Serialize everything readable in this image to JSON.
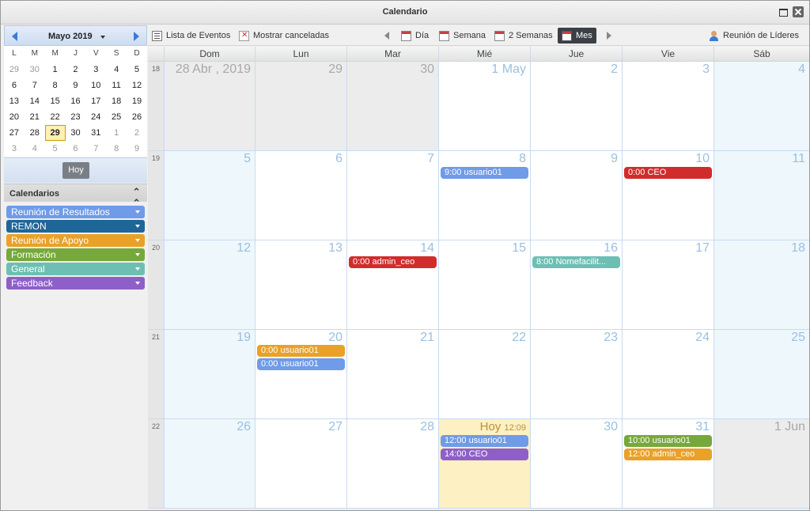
{
  "window": {
    "title": "Calendario"
  },
  "colors": {
    "reunion_resultados": "#6f9be8",
    "remon": "#1f6698",
    "reunion_apoyo": "#e9a128",
    "formacion": "#76a83b",
    "general": "#6dbfb3",
    "feedback": "#8e5fc9",
    "ceo_red": "#d12c2c"
  },
  "mini_calendar": {
    "month_label": "Mayo 2019",
    "dow": [
      "L",
      "M",
      "M",
      "J",
      "V",
      "S",
      "D"
    ],
    "weeks": [
      [
        "29",
        "30",
        "1",
        "2",
        "3",
        "4",
        "5"
      ],
      [
        "6",
        "7",
        "8",
        "9",
        "10",
        "11",
        "12"
      ],
      [
        "13",
        "14",
        "15",
        "16",
        "17",
        "18",
        "19"
      ],
      [
        "20",
        "21",
        "22",
        "23",
        "24",
        "25",
        "26"
      ],
      [
        "27",
        "28",
        "29",
        "30",
        "31",
        "1",
        "2"
      ],
      [
        "3",
        "4",
        "5",
        "6",
        "7",
        "8",
        "9"
      ]
    ],
    "today_button": "Hoy"
  },
  "calendars": {
    "header": "Calendarios",
    "items": [
      {
        "label": "Reunión de Resultados"
      },
      {
        "label": "REMON"
      },
      {
        "label": "Reunión de Apoyo"
      },
      {
        "label": "Formación"
      },
      {
        "label": "General"
      },
      {
        "label": "Feedback"
      }
    ]
  },
  "toolbar": {
    "event_list": "Lista de Eventos",
    "show_cancelled": "Mostrar canceladas",
    "day": "Día",
    "week": "Semana",
    "two_weeks": "2 Semanas",
    "month": "Mes",
    "leaders_meeting": "Reunión de Líderes"
  },
  "month_view": {
    "dow_headers": [
      "Dom",
      "Lun",
      "Mar",
      "Mié",
      "Jue",
      "Vie",
      "Sáb"
    ],
    "weeks": [
      {
        "week": "18",
        "days": [
          "28 Abr , 2019",
          "29",
          "30",
          "1 May",
          "2",
          "3",
          "4"
        ]
      },
      {
        "week": "19",
        "days": [
          "5",
          "6",
          "7",
          "8",
          "9",
          "10",
          "11"
        ]
      },
      {
        "week": "20",
        "days": [
          "12",
          "13",
          "14",
          "15",
          "16",
          "17",
          "18"
        ]
      },
      {
        "week": "21",
        "days": [
          "19",
          "20",
          "21",
          "22",
          "23",
          "24",
          "25"
        ]
      },
      {
        "week": "22",
        "days": [
          "26",
          "27",
          "28",
          "Hoy",
          "30",
          "31",
          "1 Jun"
        ]
      }
    ],
    "today_time": "12:09",
    "events": {
      "w19_wed": "9:00 usuario01",
      "w19_fri": "0:00 CEO",
      "w20_tue": "0:00 admin_ceo",
      "w20_thu": "8:00 Nomefacilit...",
      "w21_mon_1": "0:00 usuario01",
      "w21_mon_2": "0:00 usuario01",
      "w22_wed_1": "12:00 usuario01",
      "w22_wed_2": "14:00 CEO",
      "w22_fri_1": "10:00 usuario01",
      "w22_fri_2": "12:00 admin_ceo"
    }
  }
}
